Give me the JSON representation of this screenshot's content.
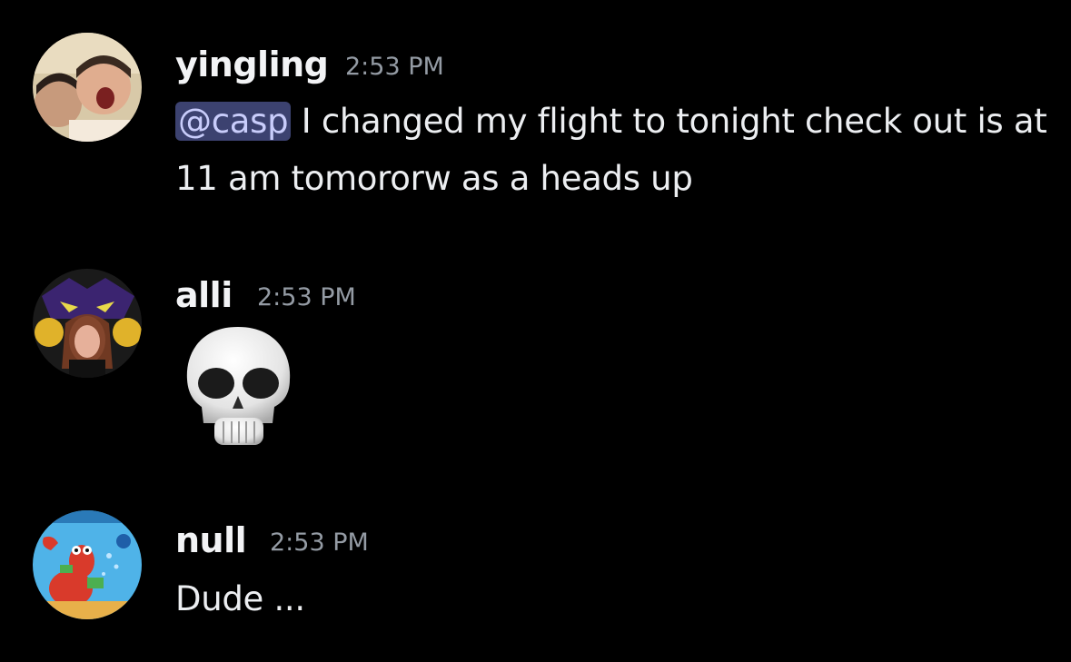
{
  "messages": [
    {
      "username": "yingling",
      "timestamp": "2:53 PM",
      "mention": "@casp",
      "text": " I changed my flight to tonight check out is at 11 am tomororw as a heads up",
      "avatar_icon": "user-avatar-photo"
    },
    {
      "username": "alli",
      "timestamp": "2:53 PM",
      "emoji": "skull-emoji",
      "avatar_icon": "user-avatar-masked-character"
    },
    {
      "username": "null",
      "timestamp": "2:53 PM",
      "text": "Dude ...",
      "avatar_icon": "user-avatar-cartoon-crab"
    }
  ],
  "colors": {
    "background": "#000000",
    "username": "#f2f3f5",
    "timestamp": "#949ba4",
    "mention_bg": "#3c4270",
    "mention_text": "#c9cdfb"
  }
}
